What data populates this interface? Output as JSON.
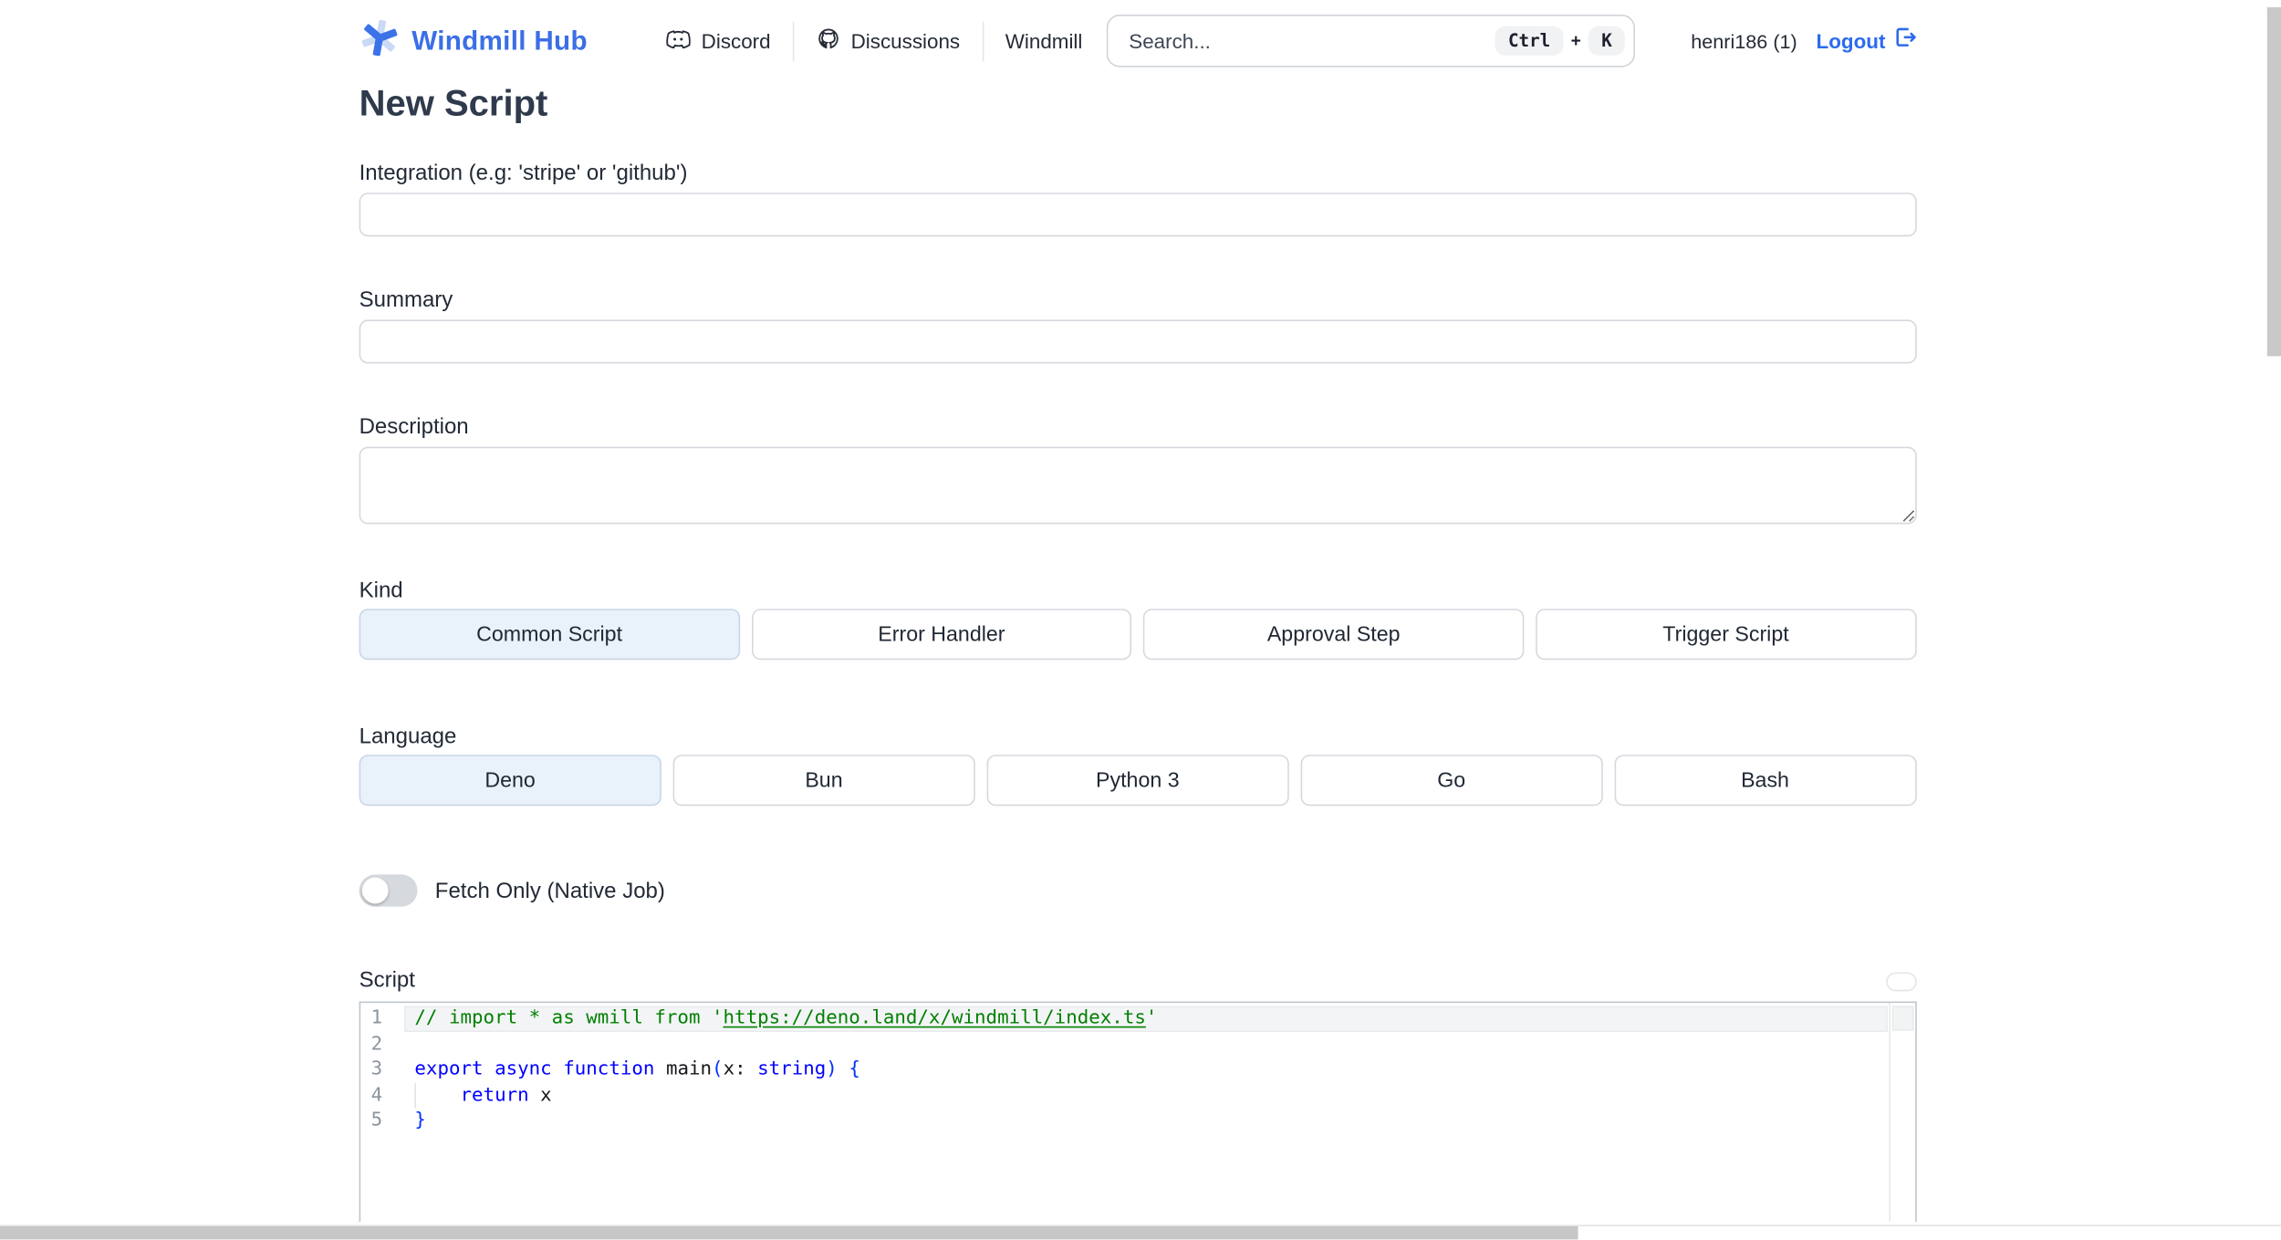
{
  "header": {
    "brand": "Windmill Hub",
    "nav": [
      {
        "label": "Discord"
      },
      {
        "label": "Discussions"
      },
      {
        "label": "Windmill"
      }
    ],
    "search": {
      "placeholder": "Search...",
      "shortcut_keys": [
        "Ctrl",
        "K"
      ],
      "shortcut_sep": "+"
    },
    "user": "henri186 (1)",
    "logout_label": "Logout"
  },
  "page": {
    "title": "New Script"
  },
  "form": {
    "integration": {
      "label": "Integration (e.g: 'stripe' or 'github')",
      "value": ""
    },
    "summary": {
      "label": "Summary",
      "value": ""
    },
    "description": {
      "label": "Description",
      "value": ""
    },
    "kind": {
      "label": "Kind",
      "options": [
        "Common Script",
        "Error Handler",
        "Approval Step",
        "Trigger Script"
      ],
      "selected": "Common Script"
    },
    "language": {
      "label": "Language",
      "options": [
        "Deno",
        "Bun",
        "Python 3",
        "Go",
        "Bash"
      ],
      "selected": "Deno"
    },
    "fetch_only": {
      "label": "Fetch Only (Native Job)",
      "enabled": false
    },
    "script": {
      "label": "Script"
    }
  },
  "editor": {
    "language": "deno",
    "lines": [
      {
        "number": "1",
        "current": true,
        "tokens": [
          {
            "t": "// import * as wmill from '",
            "c": "comment"
          },
          {
            "t": "https://deno.land/x/windmill/index.ts",
            "c": "comment-link"
          },
          {
            "t": "'",
            "c": "comment"
          }
        ]
      },
      {
        "number": "2",
        "tokens": []
      },
      {
        "number": "3",
        "tokens": [
          {
            "t": "export",
            "c": "keyword"
          },
          {
            "t": " ",
            "c": "plain"
          },
          {
            "t": "async",
            "c": "keyword"
          },
          {
            "t": " ",
            "c": "plain"
          },
          {
            "t": "function",
            "c": "keyword"
          },
          {
            "t": " ",
            "c": "plain"
          },
          {
            "t": "main",
            "c": "ident"
          },
          {
            "t": "(",
            "c": "bracket"
          },
          {
            "t": "x",
            "c": "ident"
          },
          {
            "t": ": ",
            "c": "plain"
          },
          {
            "t": "string",
            "c": "keyword"
          },
          {
            "t": ")",
            "c": "bracket"
          },
          {
            "t": " ",
            "c": "plain"
          },
          {
            "t": "{",
            "c": "bracket"
          }
        ]
      },
      {
        "number": "4",
        "indent_guide": true,
        "tokens": [
          {
            "t": "    ",
            "c": "plain"
          },
          {
            "t": "return",
            "c": "keyword"
          },
          {
            "t": " ",
            "c": "plain"
          },
          {
            "t": "x",
            "c": "ident"
          }
        ]
      },
      {
        "number": "5",
        "tokens": [
          {
            "t": "}",
            "c": "bracket"
          }
        ]
      }
    ]
  },
  "colors": {
    "brand_blue": "#3b6fe6",
    "logout_blue": "#2c6bee",
    "selected_option_bg": "#e9f1fb",
    "code_comment": "#008000",
    "code_keyword": "#0000ff",
    "scrollbar_thumb": "#c7c7c7"
  }
}
